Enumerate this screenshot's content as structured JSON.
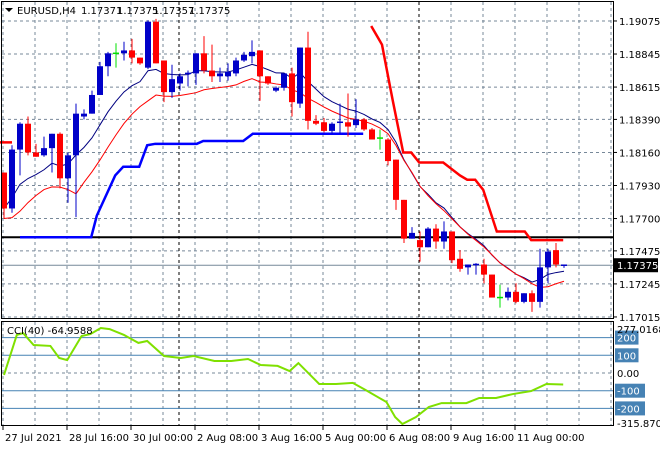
{
  "header": {
    "symbol": "EURUSD,H4",
    "open": "1.17371",
    "high": "1.17375",
    "low": "1.17357",
    "close": "1.17375"
  },
  "cci": {
    "label": "CCI(40) -64.9588",
    "max_label": "277.0168",
    "min_label": "-315.8706",
    "zero_label": "0.00",
    "levels": [
      {
        "value": 200,
        "label": "200"
      },
      {
        "value": 100,
        "label": "100"
      },
      {
        "value": -100,
        "label": "-100"
      },
      {
        "value": -200,
        "label": "-200"
      }
    ]
  },
  "current_price": "1.17375",
  "price_axis": [
    "1.19075",
    "1.18845",
    "1.18615",
    "1.18390",
    "1.18160",
    "1.17930",
    "1.17700",
    "1.17475",
    "1.17245",
    "1.17015"
  ],
  "time_axis": [
    {
      "index": 0,
      "label": "27 Jul 2021"
    },
    {
      "index": 8,
      "label": "28 Jul 16:00"
    },
    {
      "index": 16,
      "label": "30 Jul 00:00"
    },
    {
      "index": 24,
      "label": "2 Aug 08:00"
    },
    {
      "index": 32,
      "label": "3 Aug 16:00"
    },
    {
      "index": 40,
      "label": "5 Aug 00:00"
    },
    {
      "index": 48,
      "label": "6 Aug 08:00"
    },
    {
      "index": 56,
      "label": "9 Aug 16:00"
    },
    {
      "index": 64,
      "label": "11 Aug 00:00"
    }
  ],
  "colors": {
    "bull": "#0000c8",
    "bear": "#ff0000",
    "doji": "#00e000",
    "ma_fast": "#000080",
    "ma_slow": "#ff0000",
    "stop_up": "#0000ff",
    "stop_down": "#ff0000",
    "cci": "#7fe000",
    "level": "#4682b4",
    "grid": "#778899"
  },
  "chart_data": {
    "type": "candlestick",
    "title": "EURUSD,H4",
    "ylim": [
      1.17015,
      1.19221
    ],
    "period_separators": [
      22,
      52
    ],
    "horizontal_line": 1.1757,
    "candles": [
      [
        1.1802,
        1.1802,
        1.177,
        1.1777
      ],
      [
        1.1777,
        1.1821,
        1.1774,
        1.1818
      ],
      [
        1.1818,
        1.1837,
        1.18,
        1.1836
      ],
      [
        1.1836,
        1.1841,
        1.1814,
        1.1816
      ],
      [
        1.1816,
        1.1822,
        1.1813,
        1.1813
      ],
      [
        1.1814,
        1.1827,
        1.1813,
        1.1819
      ],
      [
        1.1819,
        1.1829,
        1.1802,
        1.1829
      ],
      [
        1.1829,
        1.183,
        1.1791,
        1.1798
      ],
      [
        1.1798,
        1.1816,
        1.1781,
        1.1814
      ],
      [
        1.1814,
        1.185,
        1.1771,
        1.1843
      ],
      [
        1.1841,
        1.1846,
        1.1839,
        1.1843
      ],
      [
        1.1843,
        1.1859,
        1.1843,
        1.1856
      ],
      [
        1.1856,
        1.1879,
        1.1856,
        1.1876
      ],
      [
        1.1876,
        1.1886,
        1.1869,
        1.1885
      ],
      [
        1.1885,
        1.1892,
        1.1875,
        1.1885
      ],
      [
        1.1885,
        1.1893,
        1.188,
        1.1887
      ],
      [
        1.1887,
        1.1895,
        1.1878,
        1.1882
      ],
      [
        1.1882,
        1.1882,
        1.1877,
        1.1878
      ],
      [
        1.1875,
        1.1908,
        1.1874,
        1.1907
      ],
      [
        1.1907,
        1.1909,
        1.1878,
        1.1878
      ],
      [
        1.188,
        1.188,
        1.1851,
        1.1858
      ],
      [
        1.1858,
        1.1877,
        1.1854,
        1.1867
      ],
      [
        1.1864,
        1.1871,
        1.1859,
        1.1869
      ],
      [
        1.187,
        1.1873,
        1.1862,
        1.1871
      ],
      [
        1.1871,
        1.1885,
        1.1863,
        1.1885
      ],
      [
        1.1885,
        1.1897,
        1.1871,
        1.1873
      ],
      [
        1.1873,
        1.1891,
        1.1865,
        1.1869
      ],
      [
        1.1869,
        1.1875,
        1.1865,
        1.1871
      ],
      [
        1.1869,
        1.1878,
        1.1866,
        1.1872
      ],
      [
        1.1871,
        1.1882,
        1.1869,
        1.188
      ],
      [
        1.188,
        1.1886,
        1.1879,
        1.1884
      ],
      [
        1.1883,
        1.1894,
        1.1878,
        1.1886
      ],
      [
        1.1887,
        1.1887,
        1.1852,
        1.1869
      ],
      [
        1.1869,
        1.1869,
        1.1863,
        1.1864
      ],
      [
        1.1859,
        1.1862,
        1.1858,
        1.1861
      ],
      [
        1.1861,
        1.1871,
        1.1859,
        1.1871
      ],
      [
        1.1871,
        1.1875,
        1.1841,
        1.1851
      ],
      [
        1.185,
        1.1889,
        1.1847,
        1.1889
      ],
      [
        1.1889,
        1.19,
        1.1832,
        1.1838
      ],
      [
        1.1838,
        1.1842,
        1.1835,
        1.1836
      ],
      [
        1.1837,
        1.184,
        1.183,
        1.1831
      ],
      [
        1.1831,
        1.1837,
        1.1829,
        1.1836
      ],
      [
        1.1836,
        1.185,
        1.1829,
        1.1837
      ],
      [
        1.1837,
        1.1857,
        1.1827,
        1.1834
      ],
      [
        1.1835,
        1.1853,
        1.1833,
        1.1839
      ],
      [
        1.1839,
        1.184,
        1.1831,
        1.1832
      ],
      [
        1.1832,
        1.1833,
        1.1825,
        1.1825
      ],
      [
        1.1826,
        1.1832,
        1.1818,
        1.1826
      ],
      [
        1.1825,
        1.1826,
        1.1807,
        1.181
      ],
      [
        1.1811,
        1.1811,
        1.1776,
        1.1783
      ],
      [
        1.1783,
        1.1783,
        1.1753,
        1.1756
      ],
      [
        1.1756,
        1.1764,
        1.1756,
        1.176
      ],
      [
        1.1755,
        1.1761,
        1.174,
        1.175
      ],
      [
        1.175,
        1.1764,
        1.175,
        1.1763
      ],
      [
        1.1763,
        1.1766,
        1.1749,
        1.1754
      ],
      [
        1.1754,
        1.1768,
        1.1749,
        1.1761
      ],
      [
        1.1761,
        1.1761,
        1.1739,
        1.1741
      ],
      [
        1.1742,
        1.1748,
        1.1733,
        1.1735
      ],
      [
        1.1736,
        1.1738,
        1.1731,
        1.1738
      ],
      [
        1.1737,
        1.1739,
        1.1731,
        1.1738
      ],
      [
        1.1738,
        1.1742,
        1.1725,
        1.1731
      ],
      [
        1.1731,
        1.1731,
        1.1715,
        1.1715
      ],
      [
        1.1715,
        1.1724,
        1.1708,
        1.1715
      ],
      [
        1.1715,
        1.1722,
        1.1713,
        1.1719
      ],
      [
        1.1719,
        1.1725,
        1.1711,
        1.1712
      ],
      [
        1.1712,
        1.1718,
        1.1711,
        1.1718
      ],
      [
        1.1718,
        1.172,
        1.1705,
        1.1712
      ],
      [
        1.1712,
        1.1749,
        1.1708,
        1.1736
      ],
      [
        1.1736,
        1.1749,
        1.1725,
        1.1747
      ],
      [
        1.1748,
        1.1753,
        1.1736,
        1.1738
      ],
      [
        1.17371,
        1.17375,
        1.17357,
        1.17375
      ]
    ],
    "stop_line_up": [
      [
        2,
        1.1757
      ],
      [
        10.9,
        1.1757
      ],
      [
        11.6,
        1.1772
      ],
      [
        13.9,
        1.18
      ],
      [
        14.9,
        1.1806
      ],
      [
        16.9,
        1.1806
      ],
      [
        17.9,
        1.1821
      ],
      [
        18.9,
        1.1822
      ],
      [
        24.1,
        1.1822
      ],
      [
        24.9,
        1.1824
      ],
      [
        29.9,
        1.1824
      ],
      [
        31.1,
        1.1829
      ],
      [
        44.9,
        1.1829
      ]
    ],
    "stop_line_down_prior": [
      [
        -0.5,
        1.1823
      ],
      [
        1,
        1.1823
      ]
    ],
    "stop_line_down": [
      [
        45.9,
        1.1904
      ],
      [
        47.25,
        1.1891
      ],
      [
        48.25,
        1.1862
      ],
      [
        48.6,
        1.1852
      ],
      [
        49.9,
        1.1816
      ],
      [
        50.9,
        1.1816
      ],
      [
        51.9,
        1.1809
      ],
      [
        54.9,
        1.1809
      ],
      [
        57,
        1.18
      ],
      [
        57.9,
        1.1797
      ],
      [
        58.9,
        1.1797
      ],
      [
        59.9,
        1.179
      ],
      [
        61.6,
        1.1761
      ],
      [
        65.1,
        1.1761
      ],
      [
        65.9,
        1.1755
      ],
      [
        69.9,
        1.1755
      ]
    ],
    "cci_range": [
      -315.8706,
      277.0168
    ],
    "cci_series": [
      [
        0,
        -11
      ],
      [
        1.6,
        215
      ],
      [
        2.4,
        225
      ],
      [
        3.7,
        158
      ],
      [
        5.8,
        153
      ],
      [
        6.9,
        85
      ],
      [
        7.9,
        73
      ],
      [
        9.7,
        209
      ],
      [
        10.8,
        220
      ],
      [
        12.1,
        254
      ],
      [
        13.2,
        248
      ],
      [
        15,
        215
      ],
      [
        16.8,
        170
      ],
      [
        17.9,
        181
      ],
      [
        20,
        96
      ],
      [
        22.1,
        85
      ],
      [
        23.7,
        96
      ],
      [
        26.3,
        68
      ],
      [
        28.4,
        68
      ],
      [
        30.5,
        79
      ],
      [
        32.1,
        45
      ],
      [
        34.2,
        40
      ],
      [
        35.7,
        11
      ],
      [
        36.8,
        56
      ],
      [
        39.4,
        -62
      ],
      [
        41.5,
        -62
      ],
      [
        43.6,
        -56
      ],
      [
        45.2,
        -96
      ],
      [
        47.8,
        -164
      ],
      [
        48.9,
        -249
      ],
      [
        49.8,
        -288
      ],
      [
        51.5,
        -249
      ],
      [
        53.1,
        -192
      ],
      [
        54.7,
        -170
      ],
      [
        57.8,
        -170
      ],
      [
        59.4,
        -141
      ],
      [
        61.5,
        -141
      ],
      [
        63.6,
        -119
      ],
      [
        65.9,
        -102
      ],
      [
        67.8,
        -62
      ],
      [
        69.9,
        -64.9588
      ]
    ]
  }
}
